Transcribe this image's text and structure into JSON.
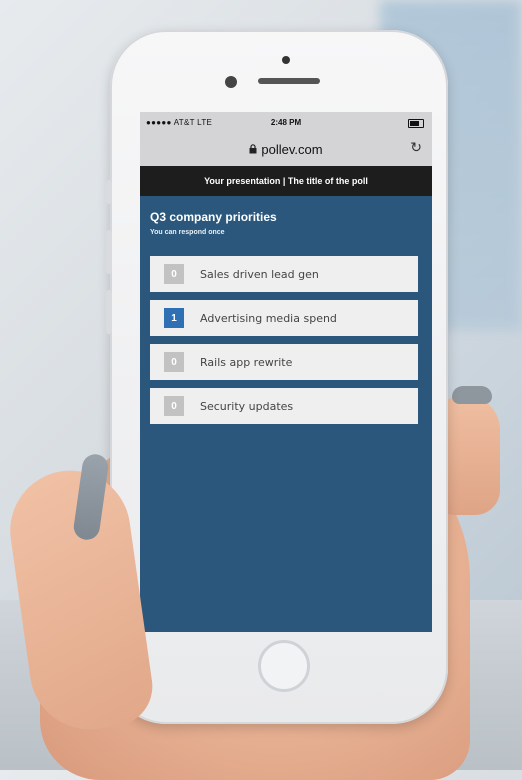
{
  "status_bar": {
    "carrier": "●●●●● AT&T  LTE",
    "time": "2:48 PM"
  },
  "browser": {
    "url": "pollev.com",
    "lock_icon": "lock-icon",
    "reload_icon": "reload-icon"
  },
  "header": {
    "text": "Your presentation | The title of the poll"
  },
  "poll": {
    "title": "Q3 company priorities",
    "subtitle": "You can respond once",
    "options": [
      {
        "count": "0",
        "label": "Sales driven lead gen",
        "selected": false
      },
      {
        "count": "1",
        "label": "Advertising media spend",
        "selected": true
      },
      {
        "count": "0",
        "label": "Rails app rewrite",
        "selected": false
      },
      {
        "count": "0",
        "label": "Security updates",
        "selected": false
      }
    ]
  },
  "colors": {
    "screen_background": "#2b577c",
    "header_background": "#1d1d1d",
    "selected_badge": "#2f6fb3",
    "unselected_badge": "#c2c2c2"
  }
}
